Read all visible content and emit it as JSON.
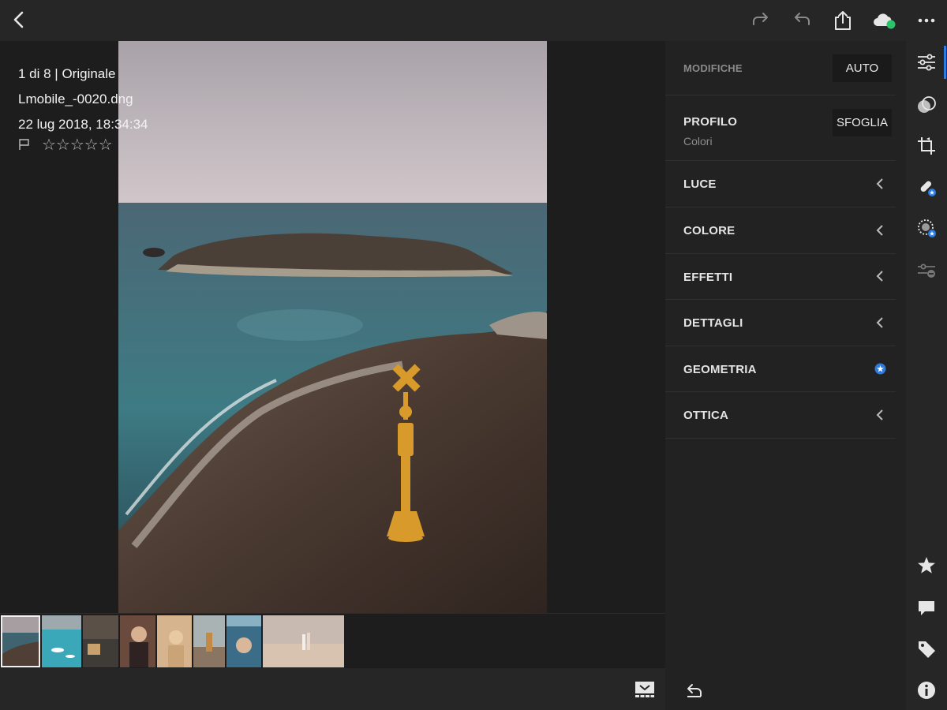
{
  "photo_info": {
    "position": "1 di 8 | Originale",
    "filename": "Lmobile_-0020.dng",
    "datetime": "22 lug 2018, 18:34:34",
    "rating_stars": "☆☆☆☆☆",
    "rating_value": 0
  },
  "edit_panel": {
    "modifiche_label": "MODIFICHE",
    "auto_button": "AUTO",
    "profile_label": "PROFILO",
    "profile_value": "Colori",
    "browse_button": "SFOGLIA",
    "sections": [
      "LUCE",
      "COLORE",
      "EFFETTI",
      "DETTAGLI",
      "GEOMETRIA",
      "OTTICA"
    ]
  },
  "filmstrip": {
    "count": 8,
    "selected_index": 0
  },
  "colors": {
    "accent": "#2d7ae0",
    "sync_dot": "#2bc36a",
    "panel_bg": "#222222",
    "bar_bg": "#262626"
  },
  "icons": {
    "topbar": [
      "back-icon",
      "redo-icon",
      "undo-icon",
      "share-icon",
      "cloud-sync-icon",
      "more-icon"
    ],
    "rail": [
      "adjustments-icon",
      "presets-icon",
      "crop-icon",
      "healing-icon",
      "selective-icon",
      "versions-icon",
      "star-icon",
      "comment-icon",
      "tag-icon",
      "info-icon"
    ],
    "bottom": [
      "filmstrip-toggle-icon",
      "reset-icon"
    ]
  }
}
